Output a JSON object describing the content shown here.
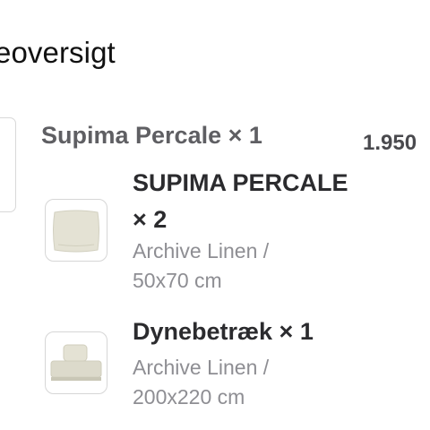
{
  "page": {
    "heading": "eoversigt"
  },
  "order": {
    "parent": {
      "title": "Supima Percale × 1",
      "price": "1.950",
      "thumbnail_icon": "bedding-set-icon"
    },
    "items": [
      {
        "title": "SUPIMA PERCALE × 2",
        "subtitle": "Archive Linen / 50x70 cm",
        "thumbnail_icon": "pillowcase-icon"
      },
      {
        "title": "Dynebetræk × 1",
        "subtitle": "Archive Linen / 200x220 cm",
        "thumbnail_icon": "duvet-bed-icon"
      }
    ]
  },
  "colors": {
    "linen": "#e3e1d2",
    "border": "#d6d6d6",
    "muted_text": "#8e8e93"
  }
}
